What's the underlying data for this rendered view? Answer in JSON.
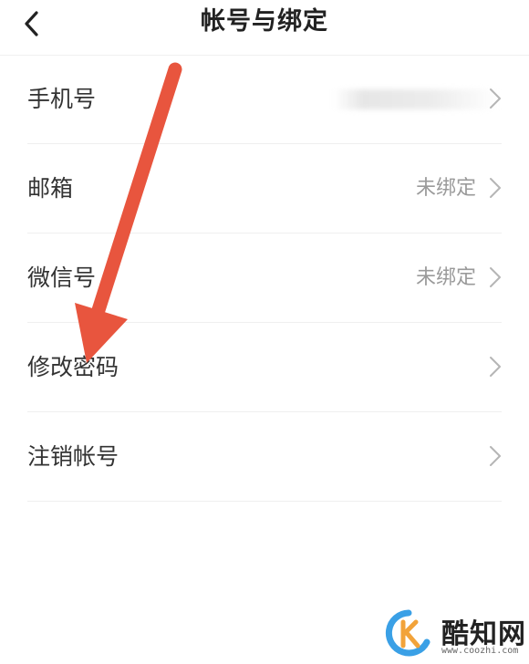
{
  "header": {
    "title": "帐号与绑定",
    "back_icon": "chevron-left-icon"
  },
  "rows": [
    {
      "label": "手机号",
      "value": "",
      "value_blurred": true
    },
    {
      "label": "邮箱",
      "value": "未绑定"
    },
    {
      "label": "微信号",
      "value": "未绑定"
    },
    {
      "label": "修改密码",
      "value": ""
    },
    {
      "label": "注销帐号",
      "value": ""
    }
  ],
  "annotation": {
    "type": "arrow",
    "color": "#e8553e"
  },
  "watermark": {
    "name": "酷知网",
    "url": "www.coozhi.com",
    "logo_colors": [
      "#3aa0e6",
      "#f2a33a"
    ]
  }
}
